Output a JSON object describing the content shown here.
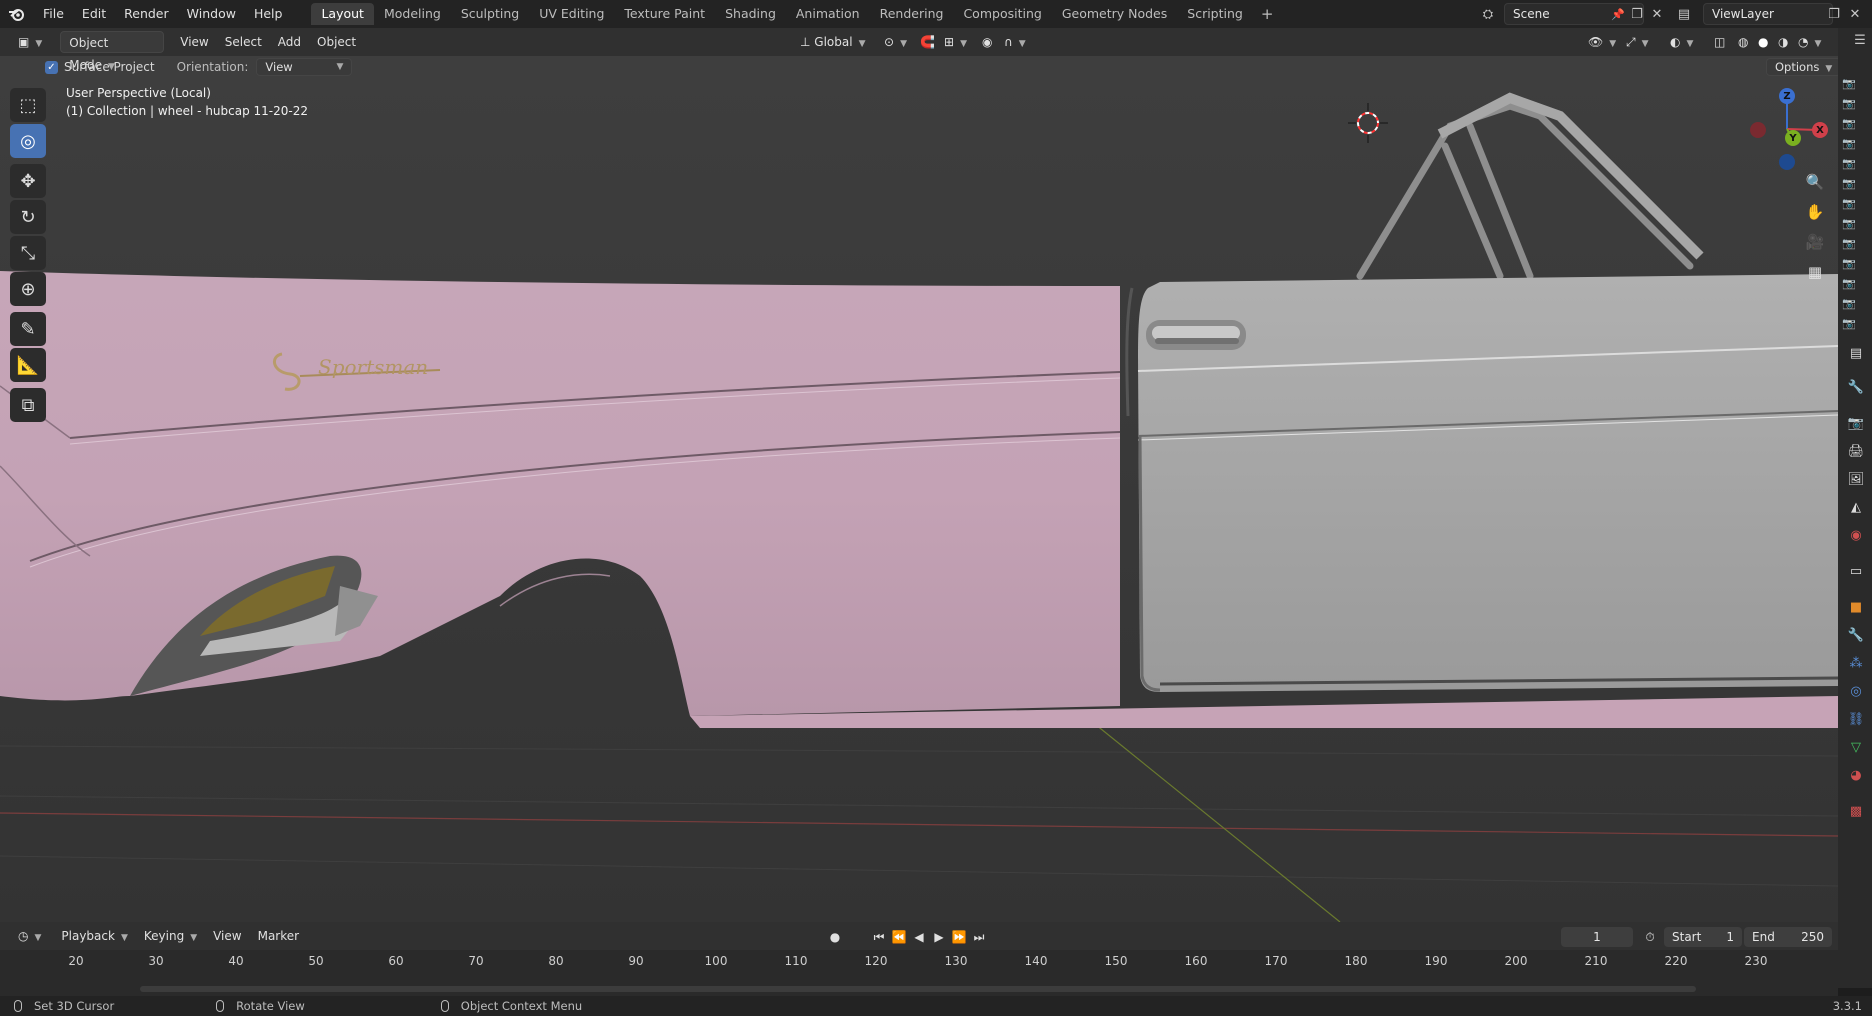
{
  "topbar": {
    "menus": [
      "File",
      "Edit",
      "Render",
      "Window",
      "Help"
    ],
    "workspaces": [
      "Layout",
      "Modeling",
      "Sculpting",
      "UV Editing",
      "Texture Paint",
      "Shading",
      "Animation",
      "Rendering",
      "Compositing",
      "Geometry Nodes",
      "Scripting"
    ],
    "active_workspace": "Layout",
    "add_tab": "+",
    "scene": "Scene",
    "view_layer": "ViewLayer"
  },
  "viewport_header": {
    "mode": "Object Mode",
    "menus": [
      "View",
      "Select",
      "Add",
      "Object"
    ],
    "transform_orientation": "Global",
    "options": "Options"
  },
  "tool_options": {
    "surface_project_label": "Surface Project",
    "surface_project_checked": true,
    "orientation_label": "Orientation:",
    "orientation_value": "View"
  },
  "viewport": {
    "perspective": "User Perspective (Local)",
    "collection_info": "(1) Collection | wheel - hubcap 11-20-22",
    "emblem_text": "Sportsman",
    "gizmo_axes": [
      "Z",
      "Y",
      "X"
    ],
    "body_color": "#c9a9bb",
    "door_color": "#a6a6a6"
  },
  "toolbar": {
    "tools": [
      "select-box",
      "cursor",
      "move",
      "rotate",
      "scale",
      "transform",
      "annotate",
      "measure",
      "add-cube"
    ],
    "active_tool": "cursor"
  },
  "timeline": {
    "menus": [
      "Playback",
      "Keying",
      "View",
      "Marker"
    ],
    "current_frame": "1",
    "start_label": "Start",
    "start_value": "1",
    "end_label": "End",
    "end_value": "250",
    "ticks": [
      "20",
      "30",
      "40",
      "50",
      "60",
      "70",
      "80",
      "90",
      "100",
      "110",
      "120",
      "130",
      "140",
      "150",
      "160",
      "170",
      "180",
      "190",
      "200",
      "210",
      "220",
      "230"
    ]
  },
  "statusbar": {
    "left_hint": "Set 3D Cursor",
    "middle_hint": "Rotate View",
    "right_hint": "Object Context Menu",
    "version": "3.3.1"
  }
}
